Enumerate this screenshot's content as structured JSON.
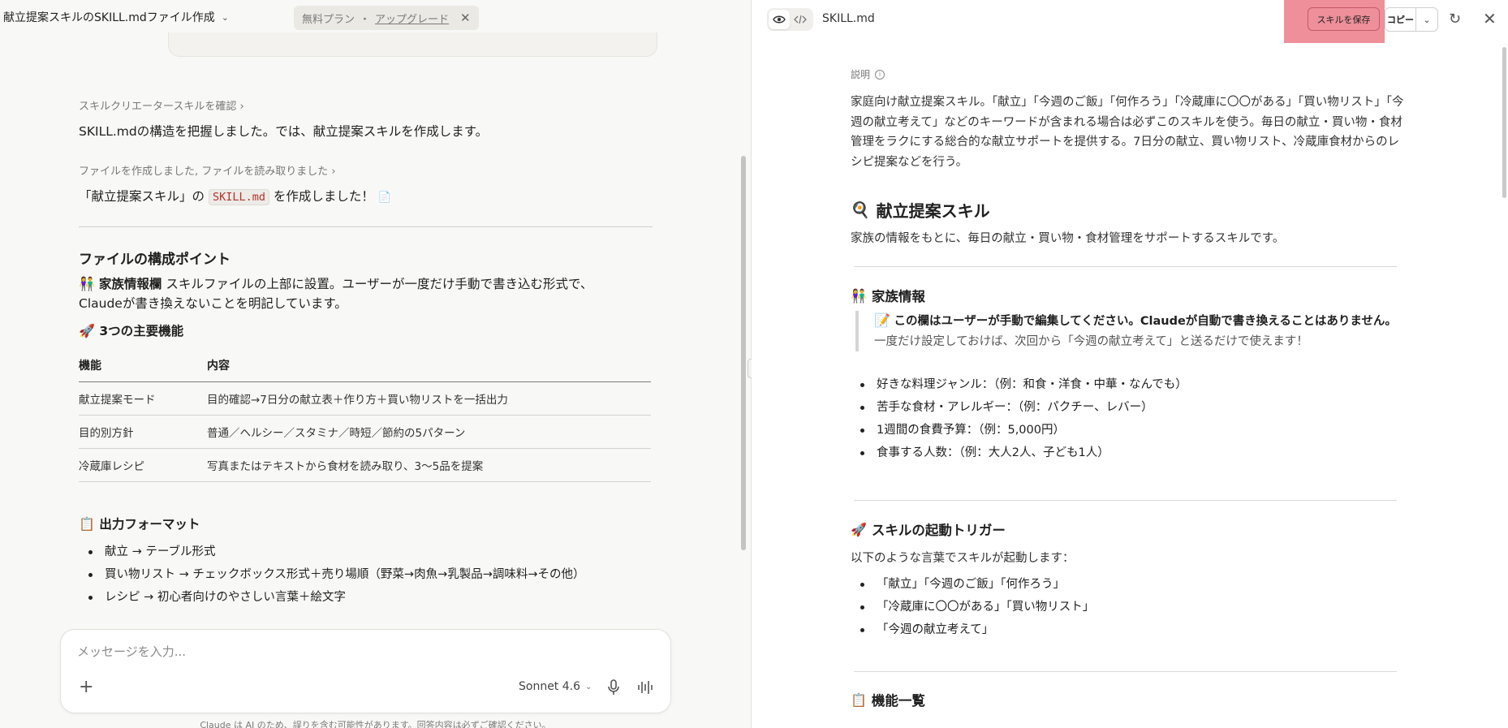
{
  "conversation": {
    "title": "献立提案スキルのSKILL.mdファイル作成",
    "plan_label": "無料プラン",
    "plan_separator": "・",
    "upgrade_label": "アップグレード"
  },
  "chat": {
    "step1_link": "スキルクリエータースキルを確認",
    "step1_text": "SKILL.mdの構造を把握しました。では、献立提案スキルを作成します。",
    "step2_link": "ファイルを作成しました, ファイルを読み取りました",
    "created_prefix": "「献立提案スキル」の",
    "created_code": "SKILL.md",
    "created_suffix": "を作成しました！",
    "section_title": "ファイルの構成ポイント",
    "family_emoji": "👫",
    "family_label": "家族情報欄",
    "family_text": "スキルファイルの上部に設置。ユーザーが一度だけ手動で書き込む形式で、",
    "family_text2": "Claudeが書き換えないことを明記しています。",
    "features_emoji": "🚀",
    "features_title": "3つの主要機能",
    "table": {
      "headers": [
        "機能",
        "内容"
      ],
      "rows": [
        [
          "献立提案モード",
          "目的確認→7日分の献立表＋作り方＋買い物リストを一括出力"
        ],
        [
          "目的別方針",
          "普通／ヘルシー／スタミナ／時短／節約の5パターン"
        ],
        [
          "冷蔵庫レシピ",
          "写真またはテキストから食材を読み取り、3〜5品を提案"
        ]
      ]
    },
    "format_emoji": "📋",
    "format_title": "出力フォーマット",
    "format_items": [
      "献立 → テーブル形式",
      "買い物リスト → チェックボックス形式＋売り場順（野菜→肉魚→乳製品→調味料→その他）",
      "レシピ → 初心者向けのやさしい言葉＋絵文字"
    ]
  },
  "composer": {
    "placeholder": "メッセージを入力...",
    "add_icon": "+",
    "model": "Sonnet 4.6",
    "disclaimer": "Claude は AI のため、誤りを含む可能性があります。回答内容は必ずご確認ください。"
  },
  "artifact": {
    "file_name": "SKILL.md",
    "save_label": "スキルを保存",
    "copy_label": "コピー",
    "desc_label": "説明",
    "desc_text": "家庭向け献立提案スキル。「献立」「今週のご飯」「何作ろう」「冷蔵庫に〇〇がある」「買い物リスト」「今週の献立考えて」などのキーワードが含まれる場合は必ずこのスキルを使う。毎日の献立・買い物・食材管理をラクにする総合的な献立サポートを提供する。7日分の献立、買い物リスト、冷蔵庫食材からのレシピ提案などを行う。",
    "h1_emoji": "🍳",
    "h1": "献立提案スキル",
    "intro": "家族の情報をもとに、毎日の献立・買い物・食材管理をサポートするスキルです。",
    "family_emoji": "👫",
    "family_title": "家族情報",
    "quote_emoji": "📝",
    "quote_bold": "この欄はユーザーが手動で編集してください。Claudeが自動で書き換えることはありません。",
    "quote_rest": "一度だけ設定しておけば、次回から「今週の献立考えて」と送るだけで使えます！",
    "family_items": [
      "好きな料理ジャンル：（例：和食・洋食・中華・なんでも）",
      "苦手な食材・アレルギー：（例：パクチー、レバー）",
      "1週間の食費予算：（例：5,000円）",
      "食事する人数：（例：大人2人、子ども1人）"
    ],
    "trigger_emoji": "🚀",
    "trigger_title": "スキルの起動トリガー",
    "trigger_intro": "以下のような言葉でスキルが起動します：",
    "trigger_items": [
      "「献立」「今週のご飯」「何作ろう」",
      "「冷蔵庫に〇〇がある」「買い物リスト」",
      "「今週の献立考えて」"
    ],
    "list_emoji": "📋",
    "list_title": "機能一覧"
  },
  "colors": {
    "save_highlight": "#ee8f9a",
    "code_text": "#b5332c",
    "left_bg": "#f8f8f6",
    "right_bg": "#ffffff"
  }
}
